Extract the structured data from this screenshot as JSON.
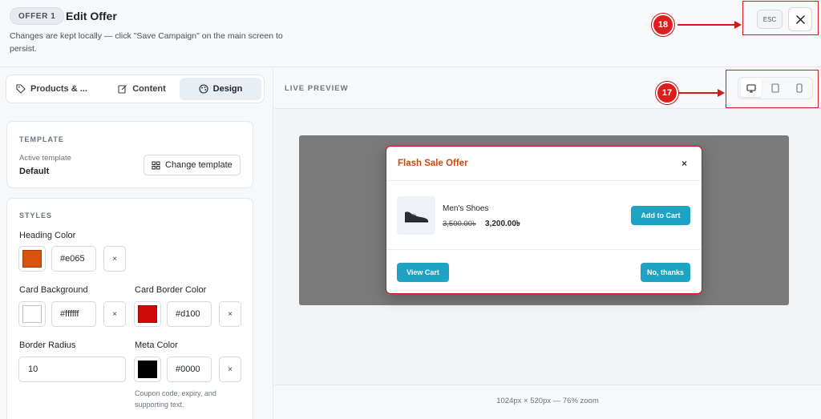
{
  "header": {
    "badge": "OFFER 1",
    "title": "Edit Offer",
    "subtitle": "Changes are kept locally — click \"Save Campaign\" on the main screen to persist.",
    "esc_label": "ESC",
    "close_icon": "close-icon"
  },
  "annotations": {
    "marker_18": "18",
    "marker_17": "17",
    "color": "#e01d1d"
  },
  "tabs": [
    {
      "label": "Products & ...",
      "icon": "tag-icon"
    },
    {
      "label": "Content",
      "icon": "edit-icon"
    },
    {
      "label": "Design",
      "icon": "palette-icon",
      "active": true
    }
  ],
  "template": {
    "section": "TEMPLATE",
    "active_label": "Active template",
    "active_value": "Default",
    "change_button": "Change template"
  },
  "styles": {
    "section": "STYLES",
    "heading_color": {
      "label": "Heading Color",
      "hex": "#e065",
      "swatch": "#d9520e"
    },
    "card_background": {
      "label": "Card Background",
      "hex": "#ffffff",
      "swatch": "#ffffff"
    },
    "card_border_color": {
      "label": "Card Border Color",
      "hex": "#d100",
      "swatch": "#cc0a0a"
    },
    "border_radius": {
      "label": "Border Radius",
      "value": "10"
    },
    "meta_color": {
      "label": "Meta Color",
      "hex": "#0000",
      "swatch": "#000000",
      "help": "Coupon code, expiry, and supporting text."
    },
    "clear_label": "×"
  },
  "preview": {
    "label": "LIVE PREVIEW",
    "devices": [
      "desktop-icon",
      "tablet-icon",
      "mobile-icon"
    ],
    "active_device": "desktop",
    "zoom_note": "1024px × 520px — 76% zoom"
  },
  "modal": {
    "title": "Flash Sale Offer",
    "close": "×",
    "product_name": "Men's Shoes",
    "price_old": "3,500.00৳",
    "price_new": "3,200.00৳",
    "add_to_cart": "Add to Cart",
    "view_cart": "View Cart",
    "no_thanks": "No, thanks",
    "accent": "#1ea3c4",
    "title_color": "#d04a10",
    "border_color": "#d1121a"
  }
}
